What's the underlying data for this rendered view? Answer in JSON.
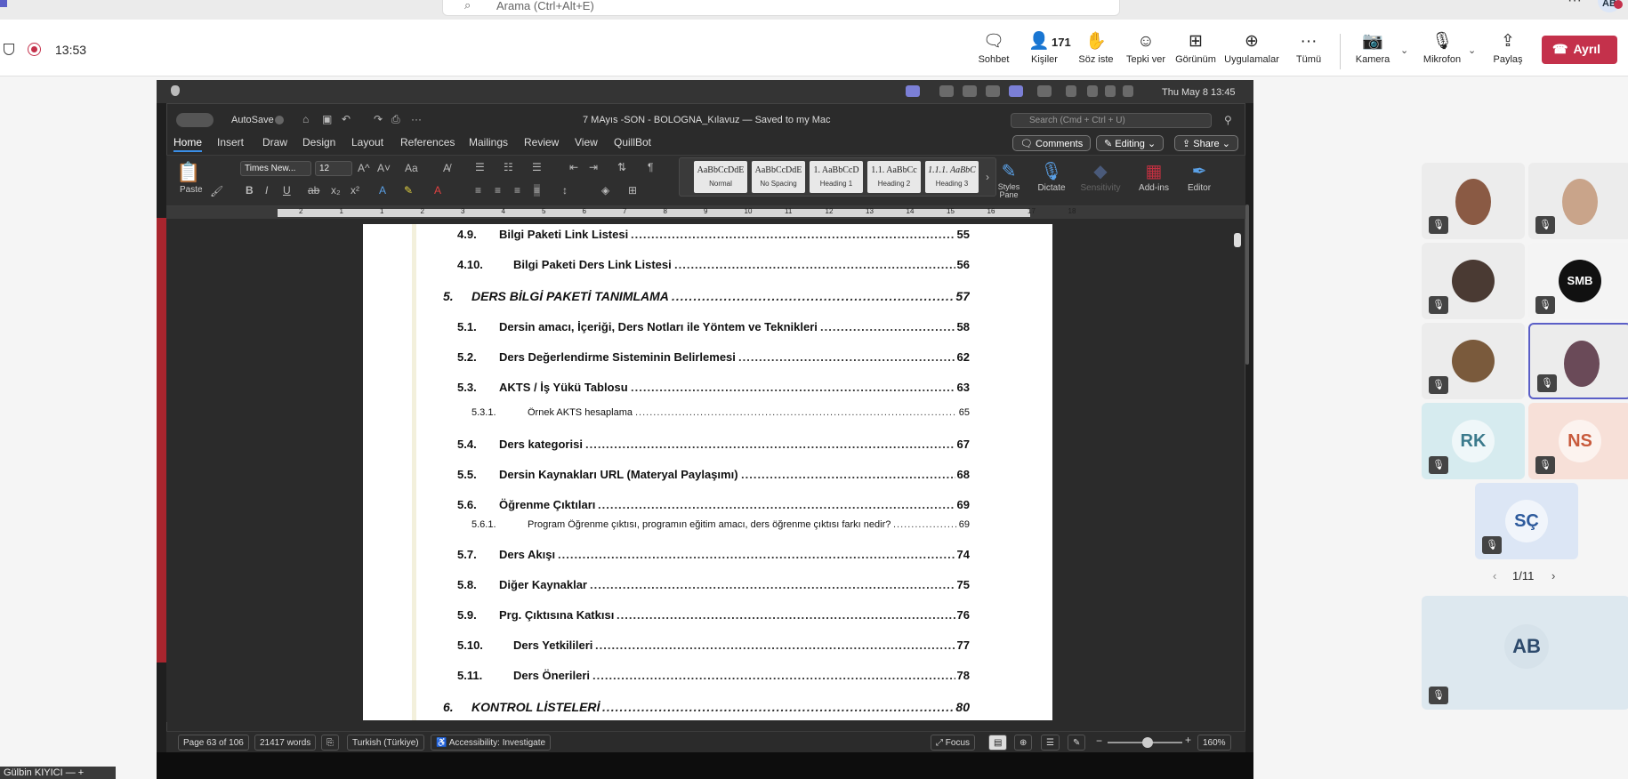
{
  "top_search": {
    "placeholder": "Arama (Ctrl+Alt+E)",
    "avatar_initials": "AB",
    "more": "···"
  },
  "meeting": {
    "timer": "13:53",
    "toolbar": [
      {
        "label": "Sohbet",
        "icon": "chat-icon"
      },
      {
        "label": "Kişiler",
        "icon": "people-icon",
        "count": "171"
      },
      {
        "label": "Söz iste",
        "icon": "raise-hand-icon"
      },
      {
        "label": "Tepki ver",
        "icon": "react-icon"
      },
      {
        "label": "Görünüm",
        "icon": "view-icon"
      },
      {
        "label": "Uygulamalar",
        "icon": "apps-icon"
      },
      {
        "label": "Tümü",
        "icon": "more-icon"
      },
      {
        "label": "Kamera",
        "icon": "camera-off-icon"
      },
      {
        "label": "Mikrofon",
        "icon": "mic-off-icon"
      },
      {
        "label": "Paylaş",
        "icon": "share-icon"
      }
    ],
    "leave_label": "Ayrıl",
    "accent": "#c4314b"
  },
  "mac": {
    "clock": "Thu May 8  13:45"
  },
  "word": {
    "autosave_label": "AutoSave",
    "doc_title": "7 MAyıs -SON - BOLOGNA_Kılavuz — Saved to my Mac",
    "search_placeholder": "Search (Cmd + Ctrl + U)",
    "tabs": [
      "Home",
      "Insert",
      "Draw",
      "Design",
      "Layout",
      "References",
      "Mailings",
      "Review",
      "View",
      "QuillBot"
    ],
    "active_tab": "Home",
    "comments_label": "Comments",
    "editing_label": "Editing",
    "share_label": "Share",
    "font_name": "Times New...",
    "font_size": "12",
    "paste_label": "Paste",
    "styles": [
      {
        "preview": "AaBbCcDdE",
        "label": "Normal"
      },
      {
        "preview": "AaBbCcDdE",
        "label": "No Spacing"
      },
      {
        "preview": "1. AaBbCcD",
        "label": "Heading 1"
      },
      {
        "preview": "1.1. AaBbCc",
        "label": "Heading 2"
      },
      {
        "preview": "1.1.1. AaBbC",
        "label": "Heading 3"
      }
    ],
    "tools": [
      {
        "label": "Styles\nPane"
      },
      {
        "label": "Dictate"
      },
      {
        "label": "Sensitivity"
      },
      {
        "label": "Add-ins"
      },
      {
        "label": "Editor"
      }
    ],
    "ruler_numbers": [
      "2",
      "1",
      "1",
      "2",
      "3",
      "4",
      "5",
      "6",
      "7",
      "8",
      "9",
      "10",
      "11",
      "12",
      "13",
      "14",
      "15",
      "16",
      "17",
      "18"
    ],
    "status": {
      "page": "Page 63 of 106",
      "words": "21417 words",
      "language": "Turkish (Türkiye)",
      "accessibility": "Accessibility: Investigate",
      "focus": "Focus",
      "zoom": "160%",
      "zoom_fraction": 0.47
    }
  },
  "toc": [
    {
      "num": "4.9.",
      "title": "Bilgi Paketi Link Listesi",
      "page": "55",
      "level": 2
    },
    {
      "num": "4.10.",
      "title": "Bilgi Paketi Ders Link Listesi",
      "page": "56",
      "level": 2
    },
    {
      "num": "5.",
      "title": "DERS BİLGİ PAKETİ TANIMLAMA",
      "page": "57",
      "level": 1
    },
    {
      "num": "5.1.",
      "title": "Dersin amacı, İçeriği, Ders Notları ile Yöntem ve Teknikleri",
      "page": "58",
      "level": 2
    },
    {
      "num": "5.2.",
      "title": "Ders Değerlendirme Sisteminin Belirlemesi",
      "page": "62",
      "level": 2
    },
    {
      "num": "5.3.",
      "title": "AKTS / İş Yükü Tablosu",
      "page": "63",
      "level": 2
    },
    {
      "num": "5.3.1.",
      "title": "Örnek AKTS hesaplama",
      "page": "65",
      "level": 3
    },
    {
      "num": "5.4.",
      "title": "Ders kategorisi",
      "page": "67",
      "level": 2
    },
    {
      "num": "5.5.",
      "title": "Dersin Kaynakları URL (Materyal Paylaşımı)",
      "page": "68",
      "level": 2
    },
    {
      "num": "5.6.",
      "title": "Öğrenme Çıktıları",
      "page": "69",
      "level": 2
    },
    {
      "num": "5.6.1.",
      "title": "Program Öğrenme çıktısı, programın eğitim amacı, ders öğrenme çıktısı farkı nedir?",
      "page": "69",
      "level": 3
    },
    {
      "num": "5.7.",
      "title": "Ders Akışı",
      "page": "74",
      "level": 2
    },
    {
      "num": "5.8.",
      "title": "Diğer Kaynaklar",
      "page": "75",
      "level": 2
    },
    {
      "num": "5.9.",
      "title": "Prg. Çıktısına Katkısı",
      "page": "76",
      "level": 2
    },
    {
      "num": "5.10.",
      "title": "Ders Yetkilileri",
      "page": "77",
      "level": 2
    },
    {
      "num": "5.11.",
      "title": "Ders Önerileri",
      "page": "78",
      "level": 2
    },
    {
      "num": "6.",
      "title": "KONTROL LİSTELERİ",
      "page": "80",
      "level": 1
    }
  ],
  "participants": {
    "tiles": [
      {
        "kind": "video",
        "face": "#8a5a44"
      },
      {
        "kind": "video",
        "face": "#c9a48a"
      },
      {
        "kind": "avatar",
        "face": "#4a3a33"
      },
      {
        "kind": "logo",
        "initials": "SMB"
      },
      {
        "kind": "avatar",
        "face": "#7a5a3c"
      },
      {
        "kind": "video",
        "face": "#6a4a58",
        "selected": true
      },
      {
        "kind": "initials",
        "initials": "RK",
        "color": "#3b7a8c",
        "bg": "#d6ebef"
      },
      {
        "kind": "initials",
        "initials": "NS",
        "color": "#c85a3c",
        "bg": "#f7e0d8"
      },
      {
        "kind": "initials",
        "initials": "SÇ",
        "color": "#2d5a9c",
        "bg": "#dce6f5"
      },
      {
        "kind": "initials",
        "initials": "AB",
        "color": "#2d4a6c",
        "bg": "#dde8ef"
      }
    ],
    "pager": "1/11"
  },
  "presenter_name": "Gülbin KIYICI"
}
